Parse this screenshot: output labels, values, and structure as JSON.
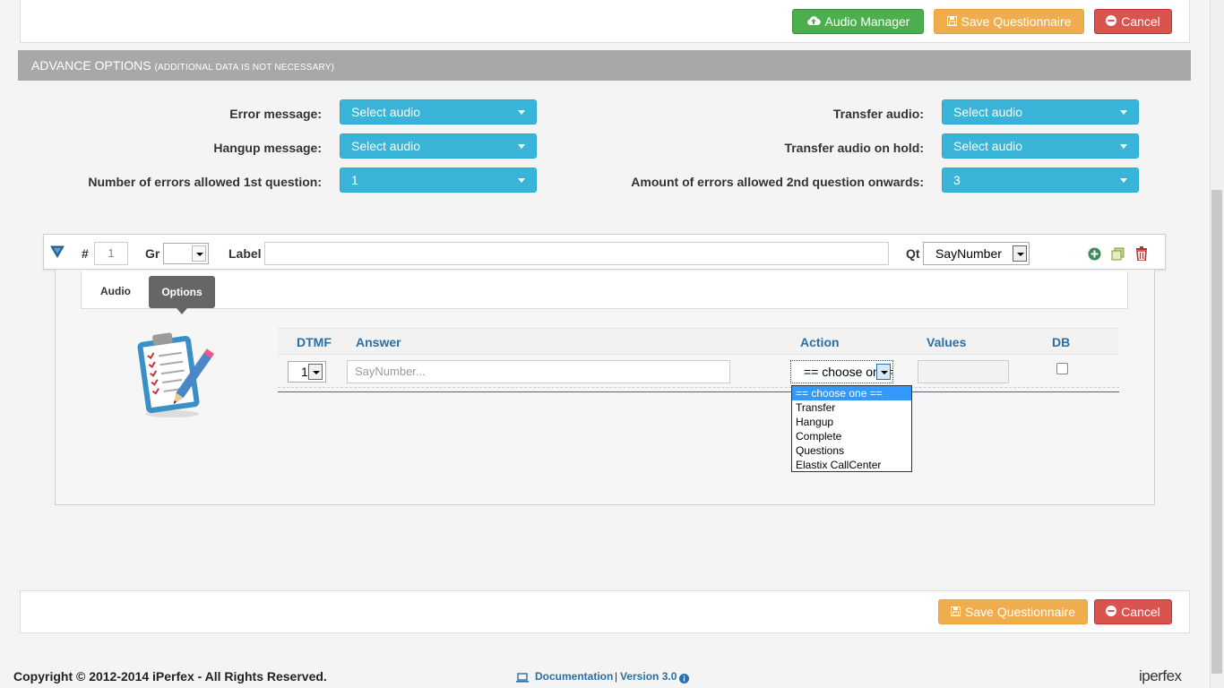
{
  "toolbar": {
    "audio_manager": "Audio Manager",
    "save": "Save Questionnaire",
    "cancel": "Cancel"
  },
  "advance": {
    "title": "ADVANCE OPTIONS",
    "subtitle": "(ADDITIONAL DATA IS NOT NECESSARY)"
  },
  "fields": {
    "error_message": {
      "label": "Error message:",
      "value": "Select audio"
    },
    "hangup_message": {
      "label": "Hangup message:",
      "value": "Select audio"
    },
    "errors_first": {
      "label": "Number of errors allowed 1st question:",
      "value": "1"
    },
    "transfer_audio": {
      "label": "Transfer audio:",
      "value": "Select audio"
    },
    "transfer_hold": {
      "label": "Transfer audio on hold:",
      "value": "Select audio"
    },
    "errors_second": {
      "label": "Amount of errors allowed 2nd question onwards:",
      "value": "3"
    }
  },
  "question": {
    "hash_label": "#",
    "number": "1",
    "gr_label": "Gr",
    "label_label": "Label",
    "label_value": "",
    "qt_label": "Qt",
    "qt_value": "SayNumber"
  },
  "tabs": [
    "Audio",
    "Options"
  ],
  "table": {
    "headers": [
      "DTMF",
      "Answer",
      "Action",
      "Values",
      "DB"
    ],
    "row": {
      "dtmf": "1",
      "answer_placeholder": "SayNumber...",
      "action": "== choose one =="
    }
  },
  "action_options": [
    "== choose one ==",
    "Transfer",
    "Hangup",
    "Complete",
    "Questions",
    "Elastix CallCenter"
  ],
  "footer": {
    "copyright": "Copyright © 2012-2014 iPerfex - All Rights Reserved.",
    "documentation": "Documentation",
    "separator": "|",
    "version": "Version 3.0",
    "brand": "iperfex"
  },
  "colors": {
    "green": "#4cae4c",
    "orange": "#f0ad4e",
    "red": "#d9534f",
    "info": "#39b3d7",
    "link": "#2a6fa8"
  }
}
